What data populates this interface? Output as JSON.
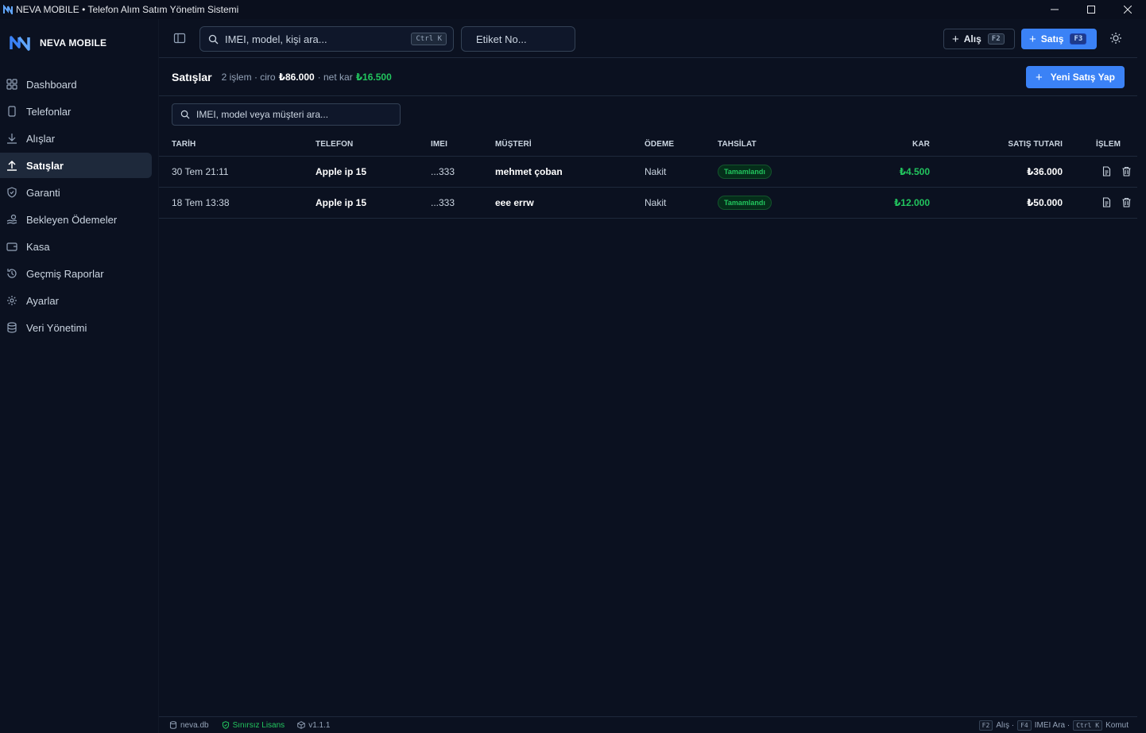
{
  "window": {
    "title": "NEVA MOBILE • Telefon Alım Satım Yönetim Sistemi"
  },
  "sidebar": {
    "brand": "NEVA MOBILE",
    "items": [
      {
        "label": "Dashboard",
        "icon": "grid-icon"
      },
      {
        "label": "Telefonlar",
        "icon": "phone-icon"
      },
      {
        "label": "Alışlar",
        "icon": "download-icon"
      },
      {
        "label": "Satışlar",
        "icon": "upload-icon",
        "active": true
      },
      {
        "label": "Garanti",
        "icon": "shield-icon"
      },
      {
        "label": "Bekleyen Ödemeler",
        "icon": "hand-coins-icon"
      },
      {
        "label": "Kasa",
        "icon": "wallet-icon"
      },
      {
        "label": "Geçmiş Raporlar",
        "icon": "history-icon"
      },
      {
        "label": "Ayarlar",
        "icon": "gear-icon"
      },
      {
        "label": "Veri Yönetimi",
        "icon": "database-icon"
      }
    ]
  },
  "topbar": {
    "search_placeholder": "IMEI, model, kişi ara...",
    "search_shortcut": "Ctrl K",
    "tag_placeholder": "Etiket No...",
    "alis_label": "Alış",
    "alis_shortcut": "F2",
    "satis_label": "Satış",
    "satis_shortcut": "F3"
  },
  "page": {
    "title": "Satışlar",
    "summary_count": "2 işlem · ciro",
    "summary_ciro": "₺86.000",
    "summary_net_label": "· net kar",
    "summary_net": "₺16.500",
    "new_button": "Yeni Satış Yap",
    "table_search_placeholder": "IMEI, model veya müşteri ara..."
  },
  "table": {
    "headers": [
      "TARİH",
      "TELEFON",
      "IMEI",
      "MÜŞTERİ",
      "ÖDEME",
      "TAHSİLAT",
      "KAR",
      "SATIŞ TUTARI",
      "İŞLEM"
    ],
    "rows": [
      {
        "date": "30 Tem 21:11",
        "phone": "Apple ip 15",
        "imei": "...333",
        "customer": "mehmet çoban",
        "payment": "Nakit",
        "status": "Tamamlandı",
        "profit": "₺4.500",
        "amount": "₺36.000"
      },
      {
        "date": "18 Tem 13:38",
        "phone": "Apple ip 15",
        "imei": "...333",
        "customer": "eee errw",
        "payment": "Nakit",
        "status": "Tamamlandı",
        "profit": "₺12.000",
        "amount": "₺50.000"
      }
    ]
  },
  "statusbar": {
    "db": "neva.db",
    "license": "Sınırsız Lisans",
    "version": "v1.1.1",
    "k1": "F2",
    "k1_label": "Alış ·",
    "k2": "F4",
    "k2_label": "IMEI Ara ·",
    "k3": "Ctrl K",
    "k3_label": "Komut"
  },
  "colors": {
    "accent": "#3b82f6",
    "success": "#22c55e",
    "background": "#0b1120"
  }
}
